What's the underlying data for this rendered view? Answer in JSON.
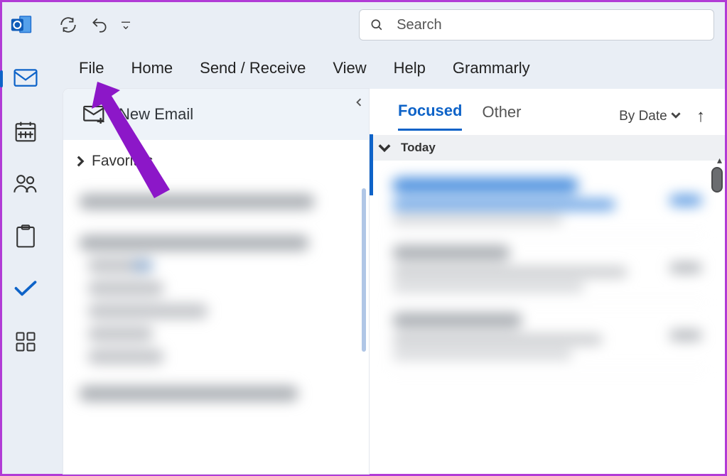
{
  "search": {
    "placeholder": "Search"
  },
  "ribbon": [
    "File",
    "Home",
    "Send / Receive",
    "View",
    "Help",
    "Grammarly"
  ],
  "new_email_label": "New Email",
  "favorites_label": "Favorites",
  "message_tabs": {
    "focused": "Focused",
    "other": "Other"
  },
  "sort_label": "By Date",
  "group_header": "Today"
}
